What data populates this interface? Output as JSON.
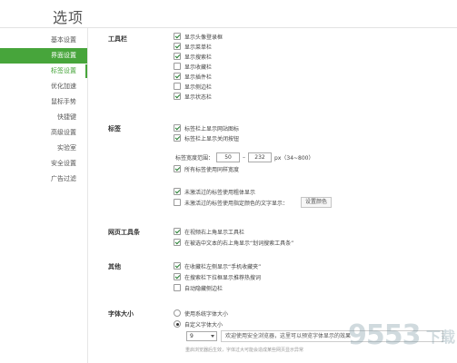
{
  "title": "选项",
  "sidebar": {
    "items": [
      {
        "label": "基本设置"
      },
      {
        "label": "界面设置"
      },
      {
        "label": "标签设置"
      },
      {
        "label": "优化加速"
      },
      {
        "label": "鼠标手势"
      },
      {
        "label": "快捷键"
      },
      {
        "label": "高级设置"
      },
      {
        "label": "实验室"
      },
      {
        "label": "安全设置"
      },
      {
        "label": "广告过滤"
      }
    ]
  },
  "toolbar": {
    "label": "工具栏",
    "options": [
      {
        "label": "显示头像登录框",
        "checked": true
      },
      {
        "label": "显示菜单栏",
        "checked": true
      },
      {
        "label": "显示搜索栏",
        "checked": true
      },
      {
        "label": "显示收藏栏",
        "checked": false
      },
      {
        "label": "显示插件栏",
        "checked": true
      },
      {
        "label": "显示侧边栏",
        "checked": false
      },
      {
        "label": "显示状态栏",
        "checked": true
      }
    ]
  },
  "tabs": {
    "label": "标签",
    "options": [
      {
        "label": "标签栏上显示网站图标",
        "checked": true
      },
      {
        "label": "标签栏上显示关闭按钮",
        "checked": true
      }
    ],
    "width_range": {
      "label": "标签宽度范围：",
      "min": "50",
      "separator": "–",
      "max": "232",
      "unit": "px（34~800）"
    },
    "same_width": {
      "label": "所有标签使用同样宽度",
      "checked": true
    },
    "unvisited_bold": {
      "label": "未激活过的标签使用粗体显示",
      "checked": true
    },
    "unvisited_color": {
      "label": "未激活过的标签使用指定颜色的文字显示：",
      "checked": false
    },
    "color_button": "设置颜色"
  },
  "webtoolbar": {
    "label": "网页工具条",
    "options": [
      {
        "label": "在视频右上角显示工具栏",
        "checked": true
      },
      {
        "label": "在被选中文本的右上角显示“划词搜索工具条”",
        "checked": true
      }
    ]
  },
  "other": {
    "label": "其他",
    "options": [
      {
        "label": "在收藏栏左侧显示“手机收藏夹”",
        "checked": true
      },
      {
        "label": "在搜索栏下拉框显示推荐热搜词",
        "checked": true
      },
      {
        "label": "自动隐藏侧边栏",
        "checked": false
      }
    ]
  },
  "fontsize": {
    "label": "字体大小",
    "options": [
      {
        "label": "使用系统字体大小",
        "checked": false
      },
      {
        "label": "自定义字体大小",
        "checked": true
      }
    ],
    "size_value": "9",
    "preview_text": "欢迎使用安全浏览器，这里可以预览字体显示的效果",
    "hint": "重启浏览器后生效，字体过大可能会造成某些网页显示异常"
  },
  "watermark": {
    "text": "9553",
    "sub": "下载"
  },
  "colors": {
    "accent": "#47a53b"
  }
}
